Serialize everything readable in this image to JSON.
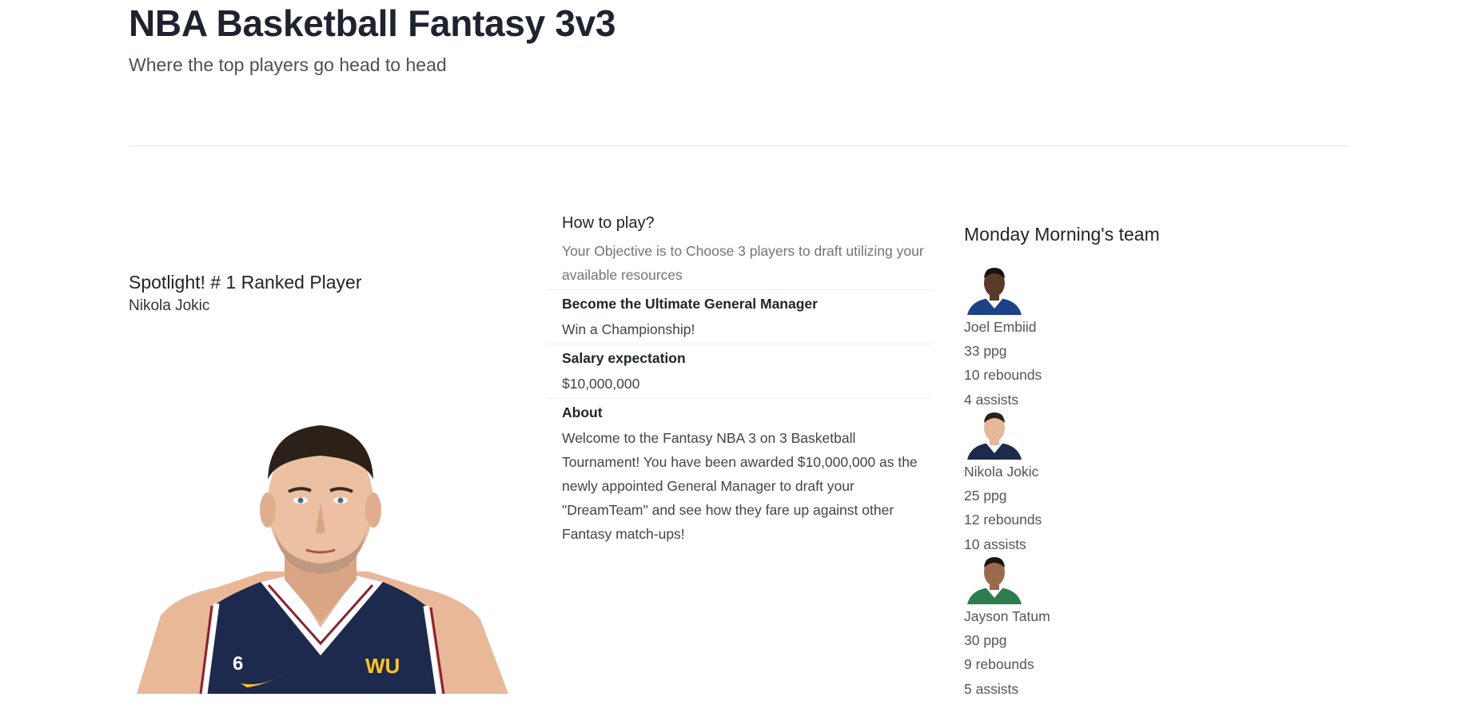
{
  "header": {
    "title": "NBA Basketball Fantasy 3v3",
    "subtitle": "Where the top players go head to head"
  },
  "spotlight": {
    "heading": "Spotlight! # 1 Ranked Player",
    "name": "Nikola Jokic",
    "jersey_number": "6",
    "jersey_sponsor": "WU",
    "jersey_sponsor_sub": "Western Union",
    "colors": {
      "jersey": "#1d2a4d",
      "trim": "#ffffff",
      "accent": "#fec524",
      "red_trim": "#8b2131"
    }
  },
  "how_to_play": {
    "title": "How to play?",
    "objective": "Your Objective is to Choose 3 players to draft utilizing your available resources",
    "rows": [
      {
        "label": "Become the Ultimate General Manager",
        "value": "Win a Championship!"
      },
      {
        "label": "Salary expectation",
        "value": "$10,000,000"
      },
      {
        "label": "About",
        "value": "Welcome to the Fantasy NBA 3 on 3 Basketball Tournament! You have been awarded $10,000,000 as the newly appointed General Manager to draft your \"DreamTeam\" and see how they fare up against other Fantasy match-ups!"
      }
    ]
  },
  "team": {
    "heading": "Monday Morning's team",
    "players": [
      {
        "name": "Joel Embiid",
        "ppg": "33 ppg",
        "rebounds": "10 rebounds",
        "assists": "4 assists",
        "jersey_color": "#1d428a",
        "skin": "#5a3a28",
        "hair": "#1a120c"
      },
      {
        "name": "Nikola Jokic",
        "ppg": "25 ppg",
        "rebounds": "12 rebounds",
        "assists": "10 assists",
        "jersey_color": "#1d2a4d",
        "skin": "#e6b89a",
        "hair": "#2b2118"
      },
      {
        "name": "Jayson Tatum",
        "ppg": "30 ppg",
        "rebounds": "9 rebounds",
        "assists": "5 assists",
        "jersey_color": "#2e7d4f",
        "skin": "#9a6a4c",
        "hair": "#1c140e"
      }
    ]
  }
}
